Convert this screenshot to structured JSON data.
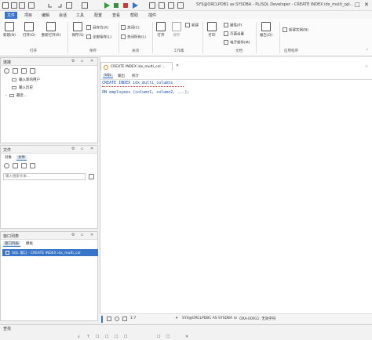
{
  "window": {
    "title": "SYS@ORCLPDB1 as SYSDBA - PL/SQL Developer - CREATE INDEX idx_multi_col..."
  },
  "menu": [
    "文件",
    "项目",
    "编辑",
    "会话",
    "工具",
    "配置",
    "查看",
    "帮助",
    "插件"
  ],
  "ribbon": {
    "new": "新建(N)",
    "open": "打开(O)",
    "reopen": "重新打开(R)",
    "save": "保存(S)",
    "save_as": "另存为(A)",
    "save_all": "全部保存(L)",
    "close": "关闭(C)",
    "close_all": "关闭所有(L)",
    "new_ws": "新建",
    "open_ws": "打开",
    "save_ws": "保存",
    "print": "打印",
    "properties": "属性(P)",
    "page_setup": "页面设置",
    "email_doc": "电子邮件(M)",
    "report": "报告(O)",
    "new_instance": "新建实例(N)",
    "groups": {
      "open": "打开",
      "save": "保存",
      "close": "关闭",
      "workspace": "工作集",
      "document": "文档",
      "application": "应用程序"
    }
  },
  "connections": {
    "title": "连接",
    "items": [
      "输入新的用户",
      "输入历史",
      "最近..."
    ]
  },
  "files": {
    "title": "文件",
    "tabs": [
      "对象",
      "文件"
    ],
    "filter_placeholder": "输入搜索文本..."
  },
  "window_list": {
    "title": "窗口列表",
    "tabs": [
      "窗口列表",
      "模板"
    ],
    "items": [
      "SQL 窗口 - CREATE INDEX idx_multi_col"
    ]
  },
  "editor": {
    "tab_label": "CREATE INDEX idx_multi_col ...",
    "subtabs": [
      "SQL",
      "输出",
      "统计"
    ],
    "lines": [
      "CREATE INDEX idx_multi_columns",
      "",
      "ON employees (column1, column2, ...);"
    ]
  },
  "status": {
    "position": "1:7",
    "connection": "SYS@ORCLPDB1 AS SYSDBA",
    "error": "ORA-00911: 无效字符"
  },
  "findbar": {
    "label": "查找"
  },
  "colors": {
    "accent": "#3874c8",
    "selection": "#3874c8",
    "code": "#1a50b3"
  }
}
